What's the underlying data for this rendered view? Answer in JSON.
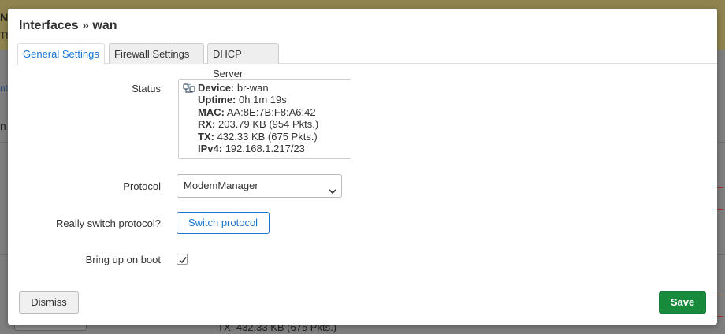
{
  "background": {
    "banner_title": "N",
    "banner_sub": "Th",
    "side_label": "nt",
    "side_label2": "n",
    "bg_tx_text": "TX: 432.33 KB (675 Pkts.)"
  },
  "modal": {
    "title": "Interfaces » wan",
    "tabs": [
      {
        "label": "General Settings",
        "active": true
      },
      {
        "label": "Firewall Settings",
        "active": false
      },
      {
        "label": "DHCP Server",
        "active": false
      }
    ],
    "status": {
      "label": "Status",
      "icon": "network-device-icon",
      "lines": [
        {
          "key": "Device:",
          "value": "br-wan"
        },
        {
          "key": "Uptime:",
          "value": "0h 1m 19s"
        },
        {
          "key": "MAC:",
          "value": "AA:8E:7B:F8:A6:42"
        },
        {
          "key": "RX:",
          "value": "203.79 KB (954 Pkts.)"
        },
        {
          "key": "TX:",
          "value": "432.33 KB (675 Pkts.)"
        },
        {
          "key": "IPv4:",
          "value": "192.168.1.217/23"
        }
      ]
    },
    "protocol": {
      "label": "Protocol",
      "selected": "ModemManager"
    },
    "switch": {
      "label": "Really switch protocol?",
      "button": "Switch protocol"
    },
    "boot": {
      "label": "Bring up on boot",
      "checked": true
    },
    "footer": {
      "dismiss": "Dismiss",
      "save": "Save"
    }
  },
  "colors": {
    "accent": "#1976d2",
    "save": "#188a3c",
    "banner": "#8f8450"
  }
}
